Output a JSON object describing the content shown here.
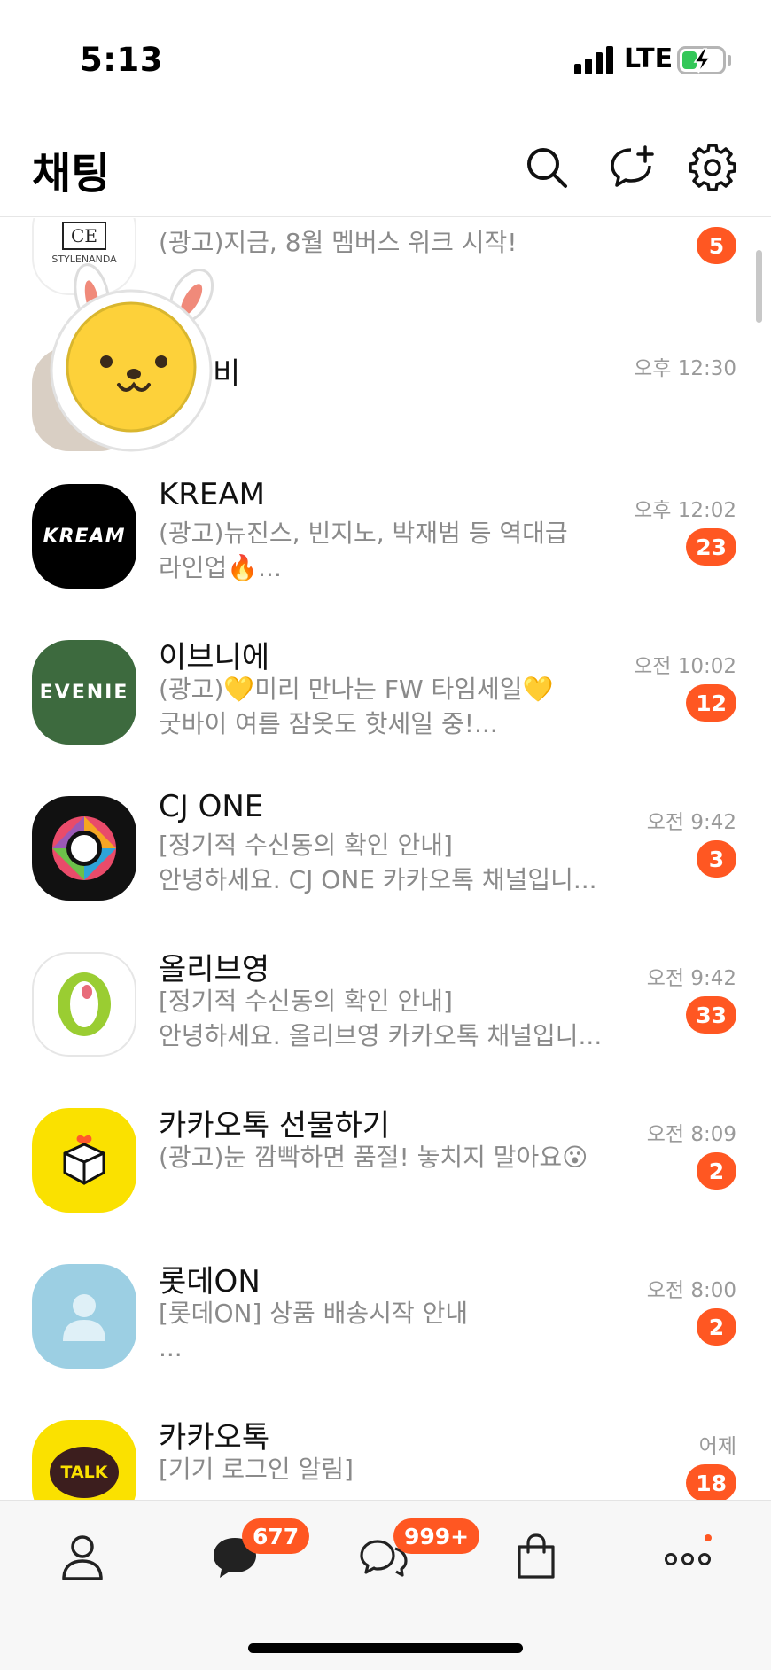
{
  "status_bar": {
    "time": "5:13",
    "network": "LTE"
  },
  "header": {
    "title": "채팅",
    "icons": [
      "search-icon",
      "new-chat-icon",
      "gear-icon"
    ]
  },
  "chats": [
    {
      "name": "",
      "preview": [
        "(광고)지금, 8월 멤버스 위크 시작!"
      ],
      "time": "",
      "badge": "5",
      "avatar_text": "CE",
      "avatar_subtext": "STYLENANDA"
    },
    {
      "name": "비",
      "preview": [],
      "time": "오후 12:30",
      "badge": ""
    },
    {
      "name": "KREAM",
      "preview": [
        "(광고)뉴진스, 빈지노, 박재범 등 역대급",
        "라인업🔥..."
      ],
      "time": "오후 12:02",
      "badge": "23",
      "avatar_text": "KREAM"
    },
    {
      "name": "이브니에",
      "preview": [
        "(광고)💛미리 만나는 FW 타임세일💛",
        "굿바이 여름 잠옷도 핫세일 중!..."
      ],
      "time": "오전 10:02",
      "badge": "12",
      "avatar_text": "EVENIE"
    },
    {
      "name": "CJ ONE",
      "preview": [
        "[정기적 수신동의 확인 안내]",
        "안녕하세요. CJ ONE 카카오톡 채널입니..."
      ],
      "time": "오전 9:42",
      "badge": "3"
    },
    {
      "name": "올리브영",
      "preview": [
        "[정기적 수신동의 확인 안내]",
        "안녕하세요. 올리브영 카카오톡 채널입니..."
      ],
      "time": "오전 9:42",
      "badge": "33"
    },
    {
      "name": "카카오톡 선물하기",
      "preview": [
        "(광고)눈 깜빡하면 품절! 놓치지 말아요😮"
      ],
      "time": "오전 8:09",
      "badge": "2"
    },
    {
      "name": "롯데ON",
      "preview": [
        "[롯데ON] 상품 배송시작 안내",
        "..."
      ],
      "time": "오전 8:00",
      "badge": "2"
    },
    {
      "name": "카카오톡",
      "preview": [
        "[기기 로그인 알림]"
      ],
      "time": "어제",
      "badge": "18",
      "avatar_text": "TALK"
    }
  ],
  "tab_bar": {
    "tabs": [
      {
        "name": "friends-tab",
        "icon": "person-icon",
        "badge": ""
      },
      {
        "name": "chats-tab",
        "icon": "chat-bubble-icon",
        "badge": "677"
      },
      {
        "name": "open-chat-tab",
        "icon": "open-chat-icon",
        "badge": "999+"
      },
      {
        "name": "shopping-tab",
        "icon": "shopping-bag-icon",
        "badge": ""
      },
      {
        "name": "more-tab",
        "icon": "more-icon",
        "badge": ""
      }
    ]
  },
  "colors": {
    "badge": "#ff5722",
    "kakao_yellow": "#fae100",
    "evenie_green": "#3d6a3e"
  }
}
